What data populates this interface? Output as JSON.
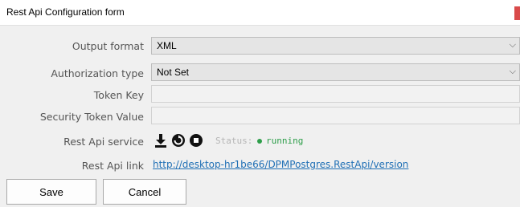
{
  "window": {
    "title": "Rest Api Configuration form"
  },
  "form": {
    "output_format": {
      "label": "Output format",
      "value": "XML"
    },
    "authorization_type": {
      "label": "Authorization type",
      "value": "Not Set"
    },
    "token_key": {
      "label": "Token Key",
      "value": ""
    },
    "security_token_value": {
      "label": "Security Token Value",
      "value": ""
    },
    "rest_api_service": {
      "label": "Rest Api service",
      "icons": [
        "download-icon",
        "refresh-icon",
        "stop-icon"
      ],
      "status_label": "Status:",
      "status_value": "running",
      "status_color": "#2e9e4a"
    },
    "rest_api_link": {
      "label": "Rest Api link",
      "url": "http://desktop-hr1be66/DPMPostgres.RestApi/version"
    }
  },
  "buttons": {
    "save": "Save",
    "cancel": "Cancel"
  },
  "colors": {
    "link": "#1f6fb5",
    "accent_red": "#d94a4a"
  }
}
